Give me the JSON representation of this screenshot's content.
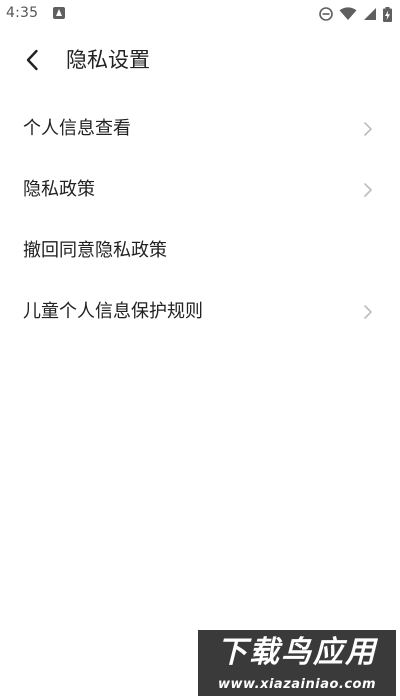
{
  "status_bar": {
    "time": "4:35",
    "icons": [
      "notification-app-icon",
      "do-not-disturb-icon",
      "wifi-icon",
      "cellular-signal-icon",
      "battery-charging-icon"
    ]
  },
  "header": {
    "back_icon": "chevron-left-icon",
    "title": "隐私设置"
  },
  "menu": {
    "items": [
      {
        "label": "个人信息查看",
        "has_chevron": true
      },
      {
        "label": "隐私政策",
        "has_chevron": true
      },
      {
        "label": "撤回同意隐私政策",
        "has_chevron": false
      },
      {
        "label": "儿童个人信息保护规则",
        "has_chevron": true
      }
    ]
  },
  "watermark": {
    "title": "下载鸟应用",
    "url": "www.xiazainiao.com"
  },
  "colors": {
    "background": "#ffffff",
    "text": "#222222",
    "chevron": "#bdbdbd",
    "watermark_bg": "#3a3a3a"
  }
}
